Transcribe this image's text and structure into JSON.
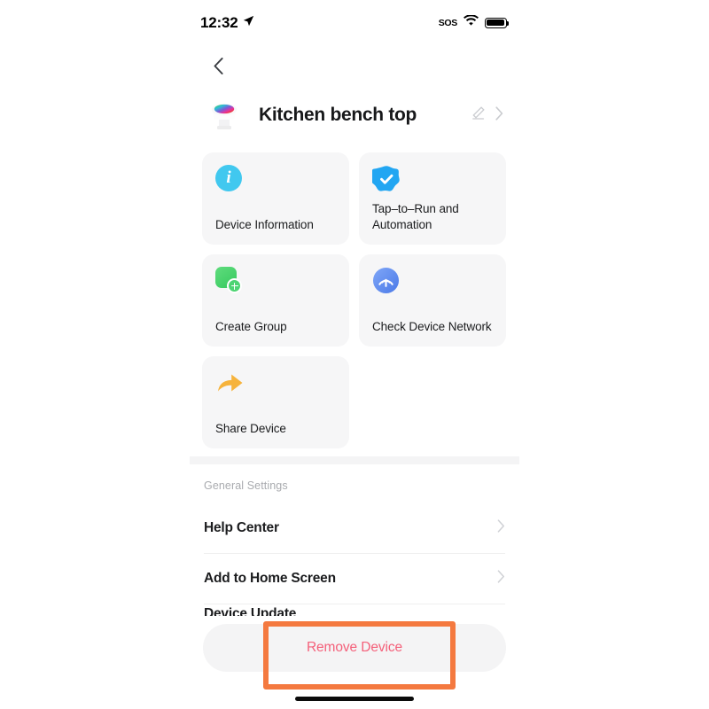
{
  "status_bar": {
    "time": "12:32",
    "location_icon": "location-arrow-icon",
    "sos_label": "SOS",
    "wifi_icon": "wifi-icon",
    "battery_icon": "battery-full-icon"
  },
  "nav": {
    "back_icon": "chevron-left-icon"
  },
  "device": {
    "name": "Kitchen bench top",
    "icon": "rgb-downlight-icon",
    "edit_icon": "pencil-edit-icon",
    "chevron_icon": "chevron-right-icon"
  },
  "cards": [
    {
      "label": "Device Information",
      "icon": "info-circle-icon",
      "color": "#41c8ef"
    },
    {
      "label": "Tap–to–Run and Automation",
      "icon": "shield-check-icon",
      "color": "#22a6f2"
    },
    {
      "label": "Create Group",
      "icon": "create-group-plus-icon",
      "color": "#4ed473"
    },
    {
      "label": "Check Device Network",
      "icon": "network-signal-icon",
      "color": "#5b8ef0"
    },
    {
      "label": "Share Device",
      "icon": "share-arrow-icon",
      "color": "#f6b33c"
    }
  ],
  "general_settings": {
    "section_title": "General Settings",
    "rows": [
      {
        "label": "Help Center",
        "chevron": "chevron-right-icon"
      },
      {
        "label": "Add to Home Screen",
        "chevron": "chevron-right-icon"
      }
    ],
    "hidden_row_label": "Device Update"
  },
  "remove": {
    "label": "Remove Device",
    "text_color": "#f4607a",
    "background": "#f4f4f5"
  },
  "annotation": {
    "target": "Remove Device",
    "color": "#f4793f"
  }
}
